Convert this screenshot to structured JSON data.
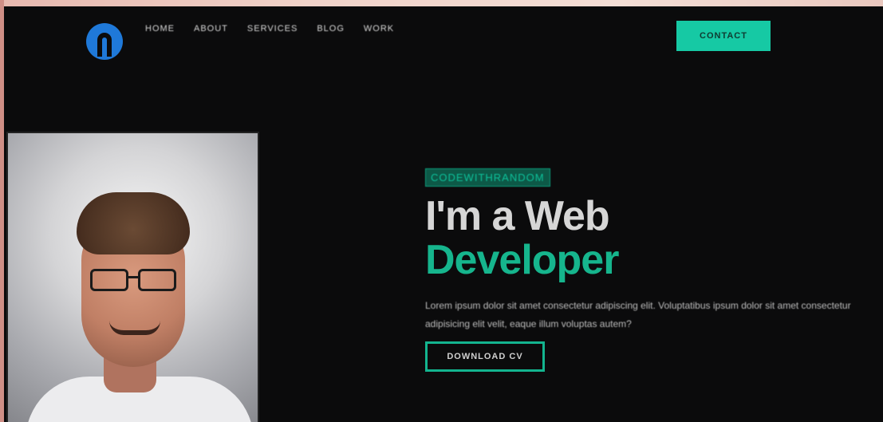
{
  "nav": {
    "links": [
      "HOME",
      "ABOUT",
      "SERVICES",
      "BLOG",
      "WORK"
    ],
    "contact_label": "CONTACT"
  },
  "hero": {
    "eyebrow": "CODEWITHRANDOM",
    "headline_line1": "I'm a Web",
    "headline_line2": "Developer",
    "description": "Lorem ipsum dolor sit amet consectetur adipiscing elit. Voluptatibus ipsum dolor sit amet consectetur adipisicing elit velit, eaque illum voluptas autem?",
    "download_label": "DOWNLOAD CV"
  },
  "colors": {
    "accent": "#16c9a4",
    "accent_text": "#16b58d",
    "background": "#0b0b0c",
    "logo": "#1f79d9"
  },
  "icons": {
    "logo": "brand-logo-icon"
  }
}
